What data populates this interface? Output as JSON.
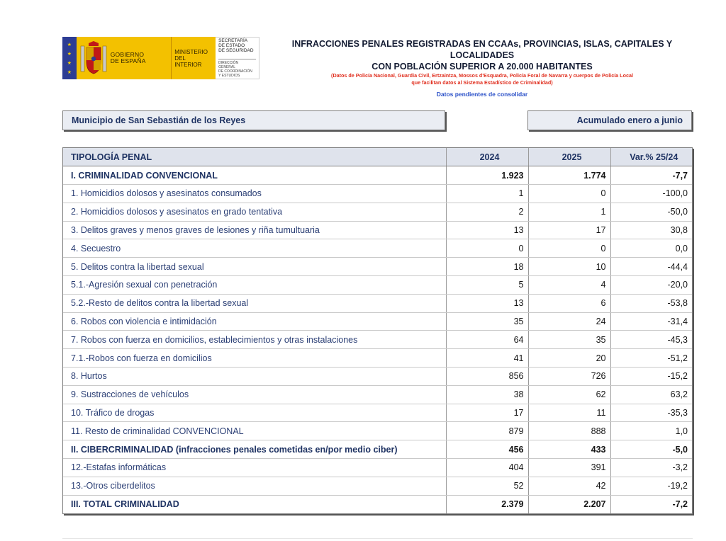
{
  "logo": {
    "government": "GOBIERNO\nDE ESPAÑA",
    "ministry": "MINISTERIO\nDEL INTERIOR",
    "secretariat": "SECRETARÍA\nDE ESTADO\nDE SEGURIDAD",
    "directorate": "DIRECCIÓN GENERAL\nDE COORDINACIÓN\nY ESTUDIOS",
    "colors": {
      "flag_blue": "#2d3d94",
      "gold": "#f3c100"
    }
  },
  "header": {
    "title_line1": "INFRACCIONES PENALES REGISTRADAS EN CCAAs, PROVINCIAS, ISLAS, CAPITALES Y LOCALIDADES",
    "title_line2": "CON POBLACIÓN SUPERIOR A 20.000 HABITANTES",
    "source_line1": "(Datos de Policía Nacional, Guardia Civil, Ertzaintza, Mossos d'Esquadra, Policía Foral de Navarra y cuerpos de Policía Local",
    "source_line2": "que facilitan datos al Sistema Estadístico de Criminalidad)",
    "pending": "Datos pendientes de consolidar"
  },
  "municipality": "Municipio de San Sebastián de los Reyes",
  "period": "Acumulado enero a junio",
  "table": {
    "headers": [
      "TIPOLOGÍA PENAL",
      "2024",
      "2025",
      "Var.% 25/24"
    ],
    "rows": [
      {
        "label": "I. CRIMINALIDAD CONVENCIONAL",
        "v2024": "1.923",
        "v2025": "1.774",
        "var": "-7,7",
        "section": true
      },
      {
        "label": "1. Homicidios dolosos y asesinatos consumados",
        "v2024": "1",
        "v2025": "0",
        "var": "-100,0"
      },
      {
        "label": "2. Homicidios dolosos y asesinatos en grado tentativa",
        "v2024": "2",
        "v2025": "1",
        "var": "-50,0"
      },
      {
        "label": "3. Delitos graves y menos graves de lesiones y riña tumultuaria",
        "v2024": "13",
        "v2025": "17",
        "var": "30,8"
      },
      {
        "label": "4. Secuestro",
        "v2024": "0",
        "v2025": "0",
        "var": "0,0"
      },
      {
        "label": "5. Delitos contra la libertad sexual",
        "v2024": "18",
        "v2025": "10",
        "var": "-44,4"
      },
      {
        "label": "5.1.-Agresión sexual con penetración",
        "v2024": "5",
        "v2025": "4",
        "var": "-20,0"
      },
      {
        "label": "5.2.-Resto de delitos contra la libertad sexual",
        "v2024": "13",
        "v2025": "6",
        "var": "-53,8"
      },
      {
        "label": "6. Robos con violencia e intimidación",
        "v2024": "35",
        "v2025": "24",
        "var": "-31,4"
      },
      {
        "label": "7. Robos con fuerza en domicilios, establecimientos y otras instalaciones",
        "v2024": "64",
        "v2025": "35",
        "var": "-45,3"
      },
      {
        "label": "7.1.-Robos con fuerza en domicilios",
        "v2024": "41",
        "v2025": "20",
        "var": "-51,2"
      },
      {
        "label": "8. Hurtos",
        "v2024": "856",
        "v2025": "726",
        "var": "-15,2"
      },
      {
        "label": "9. Sustracciones de vehículos",
        "v2024": "38",
        "v2025": "62",
        "var": "63,2"
      },
      {
        "label": "10. Tráfico de drogas",
        "v2024": "17",
        "v2025": "11",
        "var": "-35,3"
      },
      {
        "label": "11. Resto de criminalidad CONVENCIONAL",
        "v2024": "879",
        "v2025": "888",
        "var": "1,0"
      },
      {
        "label": "II. CIBERCRIMINALIDAD (infracciones penales cometidas en/por medio ciber)",
        "v2024": "456",
        "v2025": "433",
        "var": "-5,0",
        "section": true
      },
      {
        "label": "12.-Estafas informáticas",
        "v2024": "404",
        "v2025": "391",
        "var": "-3,2"
      },
      {
        "label": "13.-Otros ciberdelitos",
        "v2024": "52",
        "v2025": "42",
        "var": "-19,2"
      },
      {
        "label": "III. TOTAL CRIMINALIDAD",
        "v2024": "2.379",
        "v2025": "2.207",
        "var": "-7,2",
        "section": true,
        "total": true
      }
    ]
  }
}
